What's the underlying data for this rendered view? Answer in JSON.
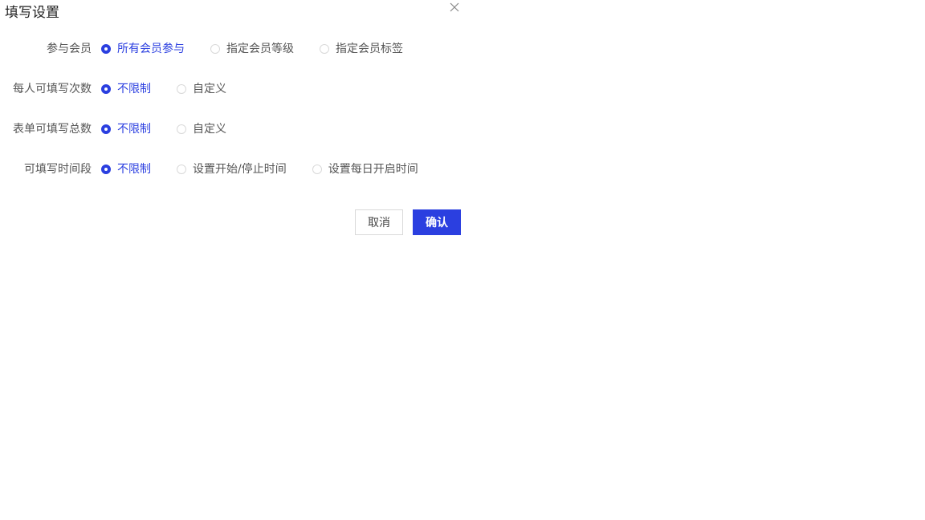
{
  "dialog": {
    "title": "填写设置",
    "close_icon": "close-icon"
  },
  "rows": [
    {
      "label": "参与会员",
      "options": [
        {
          "label": "所有会员参与",
          "checked": true
        },
        {
          "label": "指定会员等级",
          "checked": false
        },
        {
          "label": "指定会员标签",
          "checked": false
        }
      ]
    },
    {
      "label": "每人可填写次数",
      "options": [
        {
          "label": "不限制",
          "checked": true
        },
        {
          "label": "自定义",
          "checked": false
        }
      ]
    },
    {
      "label": "表单可填写总数",
      "options": [
        {
          "label": "不限制",
          "checked": true
        },
        {
          "label": "自定义",
          "checked": false
        }
      ]
    },
    {
      "label": "可填写时间段",
      "options": [
        {
          "label": "不限制",
          "checked": true
        },
        {
          "label": "设置开始/停止时间",
          "checked": false
        },
        {
          "label": "设置每日开启时间",
          "checked": false
        }
      ]
    }
  ],
  "buttons": {
    "cancel_label": "取消",
    "confirm_label": "确认"
  },
  "colors": {
    "accent": "#2b3fe0",
    "text": "#555555",
    "border": "#d9d9d9"
  }
}
